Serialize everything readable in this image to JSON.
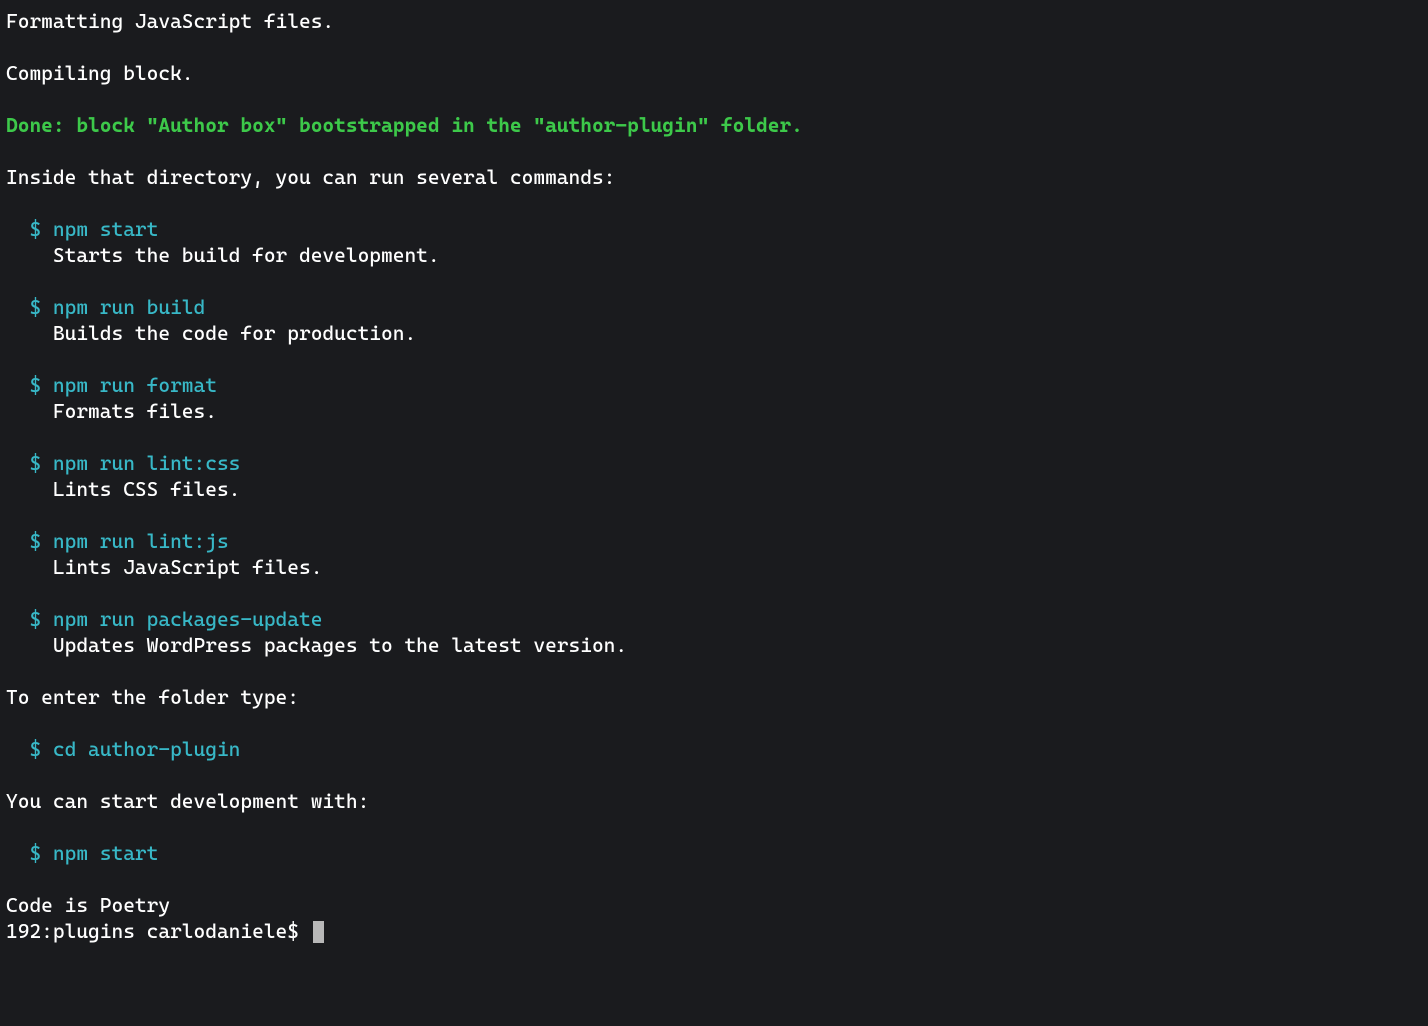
{
  "terminal": {
    "status_lines": {
      "formatting": "Formatting JavaScript files.",
      "compiling": "Compiling block."
    },
    "done_message": "Done: block \"Author box\" bootstrapped in the \"author-plugin\" folder.",
    "intro": "Inside that directory, you can run several commands:",
    "commands": [
      {
        "prefix": "  $ ",
        "cmd": "npm start",
        "desc": "    Starts the build for development."
      },
      {
        "prefix": "  $ ",
        "cmd": "npm run build",
        "desc": "    Builds the code for production."
      },
      {
        "prefix": "  $ ",
        "cmd": "npm run format",
        "desc": "    Formats files."
      },
      {
        "prefix": "  $ ",
        "cmd": "npm run lint:css",
        "desc": "    Lints CSS files."
      },
      {
        "prefix": "  $ ",
        "cmd": "npm run lint:js",
        "desc": "    Lints JavaScript files."
      },
      {
        "prefix": "  $ ",
        "cmd": "npm run packages-update",
        "desc": "    Updates WordPress packages to the latest version."
      }
    ],
    "enter_folder": "To enter the folder type:",
    "cd_cmd_prefix": "  $ ",
    "cd_cmd": "cd author-plugin",
    "start_dev": "You can start development with:",
    "npm_start_prefix": "  $ ",
    "npm_start_cmd": "npm start",
    "poetry": "Code is Poetry",
    "prompt": "192:plugins carlodaniele$ "
  }
}
